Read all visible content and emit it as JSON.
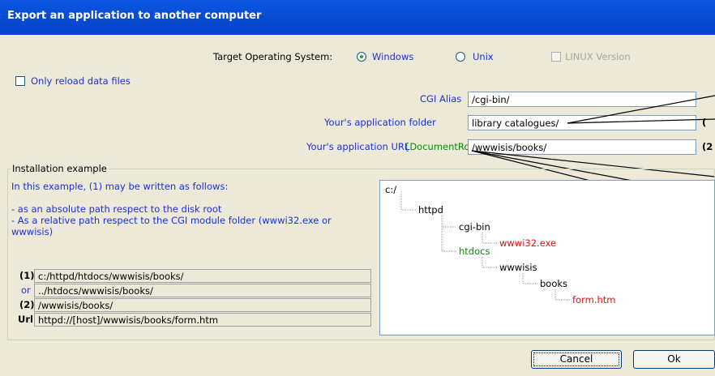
{
  "window": {
    "title": "Export an application to another computer"
  },
  "target_os": {
    "label": "Target Operating System:",
    "windows": "Windows",
    "unix": "Unix",
    "linux": "LINUX Version",
    "selected": "Windows"
  },
  "reload": {
    "label": "Only reload data files",
    "checked": false
  },
  "fields": {
    "cgi_alias_label": "CGI Alias",
    "cgi_alias_value": "/cgi-bin/",
    "app_folder_label": "Your's application folder",
    "app_folder_value": "library catalogues/",
    "app_folder_suffix": "(",
    "app_url_label": "Your's application URL",
    "app_url_hint": "{DocumentRoot}",
    "app_url_value": "/wwwisis/books/",
    "app_url_suffix": "(2"
  },
  "install": {
    "group_label": "Installation example",
    "line1": "In this example, (1) may be written as follows:",
    "line2": "- as an absolute path respect to the disk root",
    "line3": "- As a relative path respect to the CGI module folder (wwwi32.exe or",
    "line4": "wwwisis)",
    "rows": [
      {
        "label": "(1)",
        "value": "c:/httpd/htdocs/wwwisis/books/"
      },
      {
        "label": "or",
        "value": "../htdocs/wwwisis/books/"
      },
      {
        "label": "(2)",
        "value": "/wwwisis/books/"
      },
      {
        "label": "Url",
        "value": "httpd://[host]/wwwisis/books/form.htm"
      }
    ]
  },
  "tree": {
    "root": "c:/",
    "httpd": "httpd",
    "cgi_bin": "cgi-bin",
    "wwwi32": "wwwi32.exe",
    "htdocs": "htdocs",
    "wwwisis": "wwwisis",
    "books": "books",
    "form": "form.htm"
  },
  "buttons": {
    "cancel": "Cancel",
    "ok": "Ok"
  },
  "colors": {
    "title": "#0a55e0",
    "blue_text": "#1c32d8",
    "green_text": "#0a8a0a",
    "red_text": "#e01010"
  }
}
